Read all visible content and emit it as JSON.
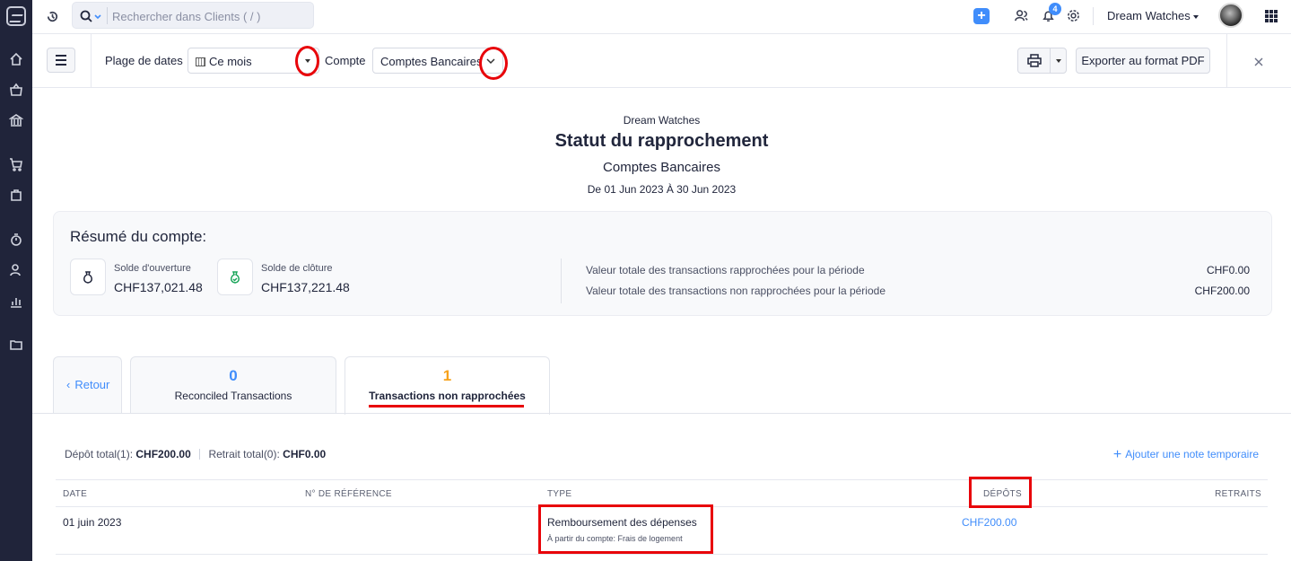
{
  "topbar": {
    "search_placeholder": "Rechercher dans Clients ( / )",
    "notifications_count": "4",
    "org_name": "Dream Watches"
  },
  "filters": {
    "date_range_label": "Plage de dates",
    "date_range_value": "Ce mois",
    "account_label": "Compte",
    "account_value": "Comptes Bancaires",
    "export_label": "Exporter au format PDF"
  },
  "report": {
    "org": "Dream Watches",
    "title": "Statut du rapprochement",
    "subtitle": "Comptes Bancaires",
    "range": "De 01 Jun 2023  À 30 Jun 2023"
  },
  "summary": {
    "heading": "Résumé du compte:",
    "opening_label": "Solde d'ouverture",
    "opening_value": "CHF137,021.48",
    "closing_label": "Solde de clôture",
    "closing_value": "CHF137,221.48",
    "reconciled_label": "Valeur totale des transactions rapprochées pour la période",
    "reconciled_value": "CHF0.00",
    "unreconciled_label": "Valeur totale des transactions non rapprochées pour la période",
    "unreconciled_value": "CHF200.00"
  },
  "tabs": {
    "back": "Retour",
    "reconciled_count": "0",
    "reconciled_label": "Reconciled Transactions",
    "unreconciled_count": "1",
    "unreconciled_label": "Transactions non rapprochées"
  },
  "totals": {
    "deposit_label": "Dépôt total(1):",
    "deposit_value": "CHF200.00",
    "withdrawal_label": "Retrait total(0):",
    "withdrawal_value": "CHF0.00",
    "add_note": "Ajouter une note temporaire"
  },
  "table": {
    "headers": [
      "DATE",
      "N° DE RÉFÉRENCE",
      "TYPE",
      "DÉPÔTS",
      "RETRAITS"
    ],
    "rows": [
      {
        "date": "01 juin 2023",
        "reference": "",
        "type": "Remboursement des dépenses",
        "type_detail": "À partir du compte: Frais de logement",
        "deposit": "CHF200.00",
        "withdrawal": ""
      }
    ]
  },
  "colors": {
    "accent": "#408dfb",
    "highlight": "#e8040a",
    "unreconciled_count": "#f7a21b",
    "sidebar": "#20243a"
  }
}
